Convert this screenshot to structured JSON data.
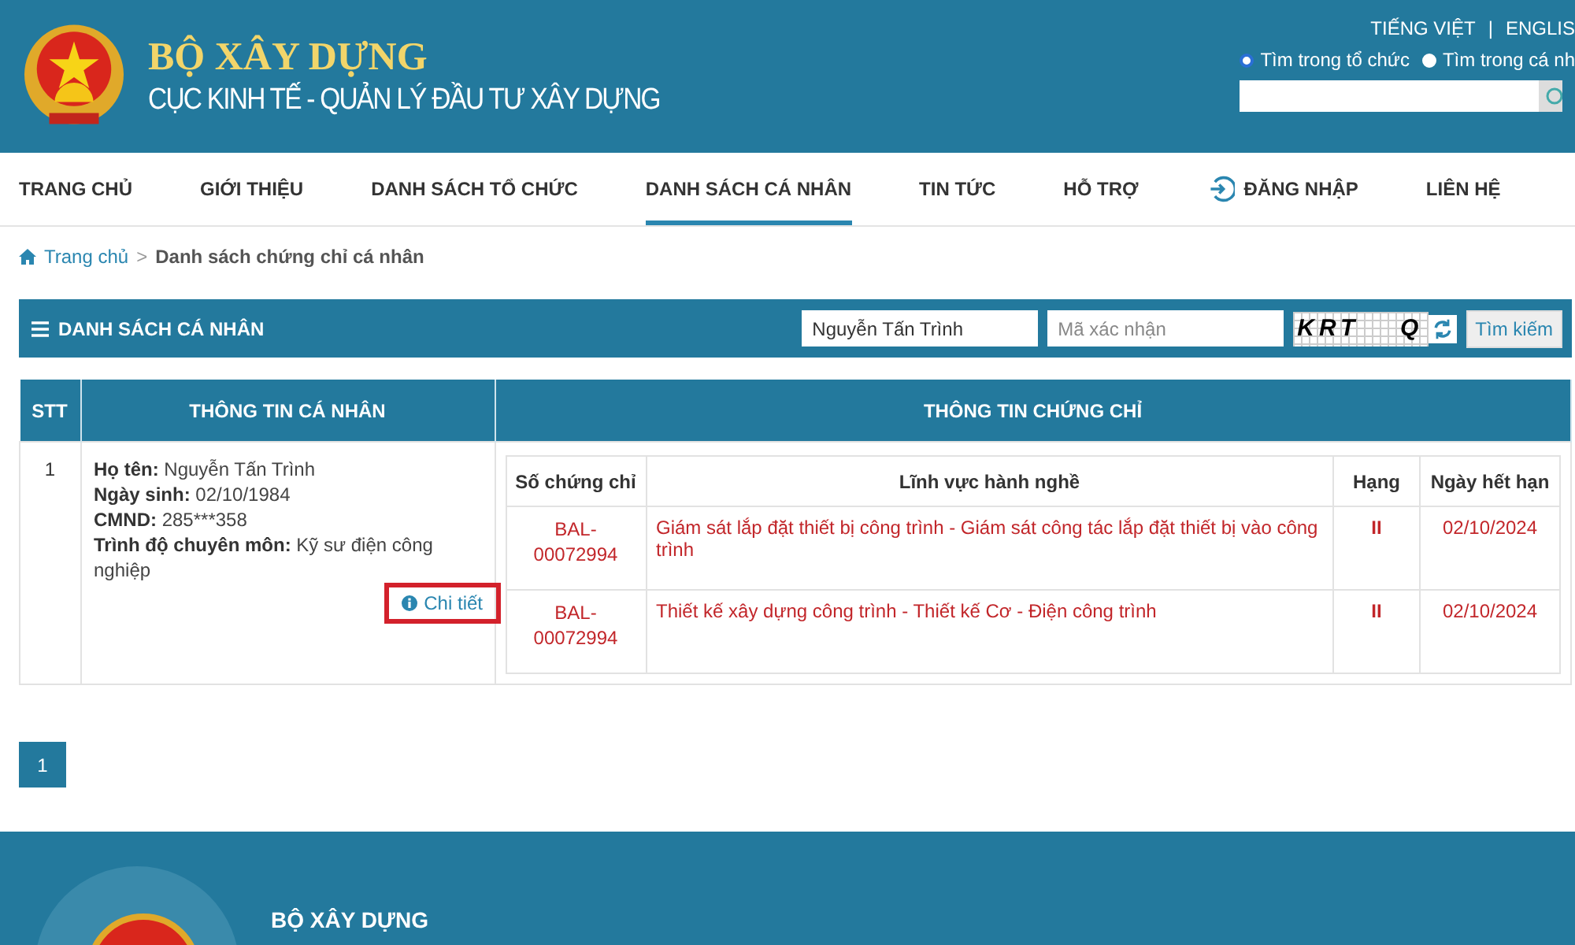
{
  "header": {
    "title": "BỘ XÂY DỰNG",
    "subtitle": "CỤC KINH TẾ - QUẢN LÝ ĐẦU TƯ XÂY DỰNG",
    "languages": [
      "TIẾNG VIỆT",
      "|",
      "ENGLIS"
    ],
    "search_scope": [
      {
        "label": "Tìm trong tổ chức",
        "selected": true
      },
      {
        "label": "Tìm trong cá nh",
        "selected": false
      }
    ]
  },
  "nav": [
    {
      "label": "TRANG CHỦ",
      "selected": false,
      "kind": "text"
    },
    {
      "label": "GIỚI THIỆU",
      "selected": false,
      "kind": "text"
    },
    {
      "label": "DANH SÁCH TỔ CHỨC",
      "selected": false,
      "kind": "text"
    },
    {
      "label": "DANH SÁCH CÁ NHÂN",
      "selected": true,
      "kind": "text"
    },
    {
      "label": "TIN TỨC",
      "selected": false,
      "kind": "text"
    },
    {
      "label": "HỖ TRỢ",
      "selected": false,
      "kind": "text"
    },
    {
      "label": "ĐĂNG NHẬP",
      "selected": false,
      "kind": "login"
    },
    {
      "label": "LIÊN HỆ",
      "selected": false,
      "kind": "text"
    }
  ],
  "breadcrumb": [
    "Trang chủ",
    ">",
    "Danh sách chứng chỉ cá nhân"
  ],
  "panel": {
    "title": "DANH SÁCH CÁ NHÂN",
    "name_field": {
      "value": "Nguyễn Tấn Trình"
    },
    "code_field": {
      "placeholder": "Mã xác nhận"
    },
    "captcha": [
      "KRT",
      "Q"
    ],
    "search_button": "Tìm kiếm"
  },
  "table": {
    "columns": [
      "STT",
      "THÔNG TIN CÁ NHÂN",
      "THÔNG TIN CHỨNG CHỈ"
    ],
    "rows": [
      {
        "stt": "1",
        "info": [
          {
            "label": "Họ tên:",
            "value": "Nguyễn Tấn Trình"
          },
          {
            "label": "Ngày sinh:",
            "value": "02/10/1984"
          },
          {
            "label": "CMND:",
            "value": "285***358"
          },
          {
            "label": "Trình độ chuyên môn:",
            "value": "Kỹ sư điện công nghiệp"
          }
        ],
        "detail_link": {
          "label": "Chi tiết",
          "highlighted": true
        },
        "certificates": {
          "columns": [
            "Số chứng chỉ",
            "Lĩnh vực hành nghề",
            "Hạng",
            "Ngày hết hạn"
          ],
          "rows": [
            [
              "BAL-\n00072994",
              "Giám sát lắp đặt thiết bị công trình - Giám sát công tác lắp đặt thiết bị vào công trình",
              "II",
              "02/10/2024"
            ],
            [
              "BAL-\n00072994",
              "Thiết kế xây dựng công trình - Thiết kế Cơ - Điện công trình",
              "II",
              "02/10/2024"
            ]
          ]
        }
      }
    ]
  },
  "pagination": [
    {
      "label": "1",
      "selected": true
    }
  ],
  "footer": {
    "title": "BỘ XÂY DỰNG"
  }
}
